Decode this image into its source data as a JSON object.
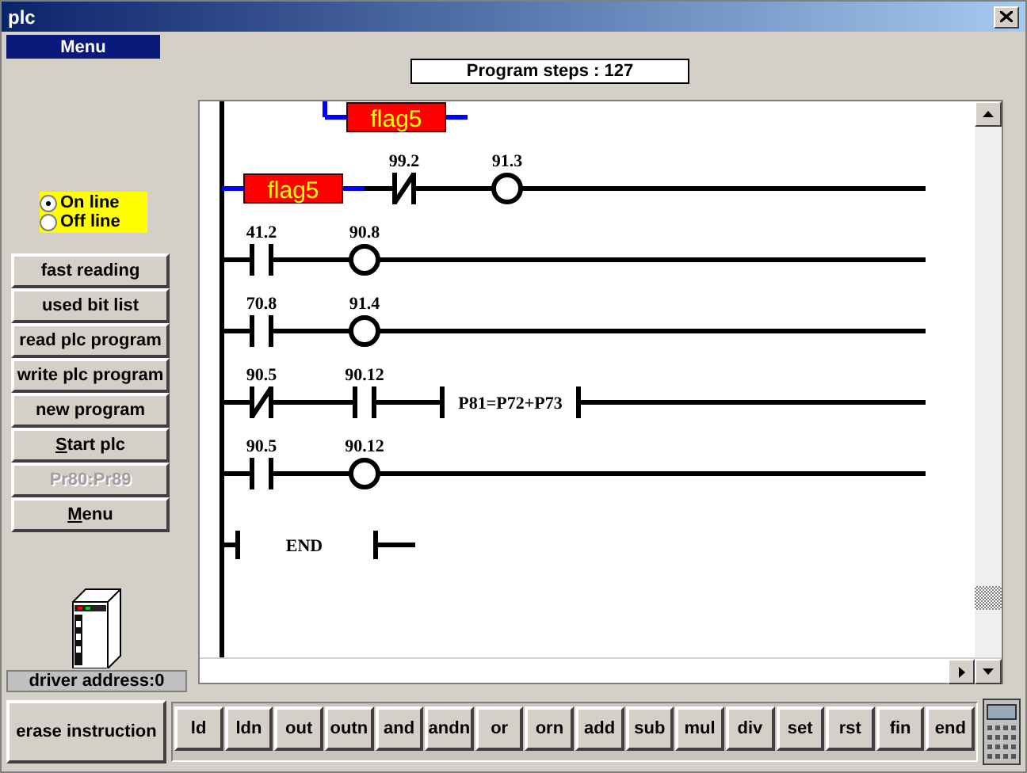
{
  "window": {
    "title": "plc"
  },
  "menu_bar": {
    "label": "Menu"
  },
  "program_steps": "Program steps : 127",
  "mode": [
    {
      "label": "On line",
      "selected": true
    },
    {
      "label": "Off line",
      "selected": false
    }
  ],
  "buttons": [
    {
      "label": "fast reading",
      "disabled": false,
      "mnemonic": false
    },
    {
      "label": "used bit list",
      "disabled": false,
      "mnemonic": false
    },
    {
      "label": "read plc program",
      "disabled": false,
      "mnemonic": false
    },
    {
      "label": "write plc program",
      "disabled": false,
      "mnemonic": false
    },
    {
      "label": "new program",
      "disabled": false,
      "mnemonic": false
    },
    {
      "label": "Start plc",
      "disabled": false,
      "mnemonic": true
    },
    {
      "label": "Pr80:Pr89",
      "disabled": true,
      "mnemonic": false
    },
    {
      "label": "Menu",
      "disabled": false,
      "mnemonic": true
    }
  ],
  "driver_address": "driver address:0",
  "ladder": {
    "rungs": [
      {
        "elements": [
          {
            "kind": "branch"
          },
          {
            "kind": "flag",
            "label": "flag5"
          }
        ]
      },
      {
        "elements": [
          {
            "kind": "flag",
            "label": "flag5"
          },
          {
            "kind": "nc",
            "label": "99.2"
          },
          {
            "kind": "coil",
            "label": "91.3"
          }
        ]
      },
      {
        "elements": [
          {
            "kind": "no",
            "label": "41.2"
          },
          {
            "kind": "coil",
            "label": "90.8"
          }
        ]
      },
      {
        "elements": [
          {
            "kind": "no",
            "label": "70.8"
          },
          {
            "kind": "coil",
            "label": "91.4"
          }
        ]
      },
      {
        "elements": [
          {
            "kind": "nc",
            "label": "90.5"
          },
          {
            "kind": "no",
            "label": "90.12"
          },
          {
            "kind": "block",
            "label": "P81=P72+P73"
          }
        ]
      },
      {
        "elements": [
          {
            "kind": "no",
            "label": "90.5"
          },
          {
            "kind": "coil",
            "label": "90.12"
          }
        ]
      },
      {
        "elements": [
          {
            "kind": "end",
            "label": "END"
          }
        ]
      }
    ]
  },
  "erase_button": "erase instruction",
  "instructions": [
    "ld",
    "ldn",
    "out",
    "outn",
    "and",
    "andn",
    "or",
    "orn",
    "add",
    "sub",
    "mul",
    "div",
    "set",
    "rst",
    "fin",
    "end"
  ]
}
